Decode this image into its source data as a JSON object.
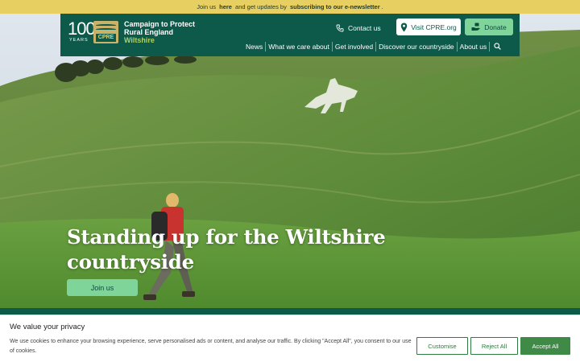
{
  "topbar": {
    "prefix": "Join us",
    "here_link": "here",
    "middle": "and get updates by",
    "subscribe_link": "subscribing to our e-newsletter",
    "suffix": "."
  },
  "logo": {
    "number": "100",
    "years": "YEARS",
    "badge": "CPRE"
  },
  "org": {
    "line1": "Campaign to Protect",
    "line2": "Rural England",
    "line3": "Wiltshire"
  },
  "header": {
    "contact_label": "Contact us",
    "visit_label": "Visit CPRE.org",
    "donate_label": "Donate"
  },
  "nav": {
    "items": [
      "News",
      "What we care about",
      "Get involved",
      "Discover our countryside",
      "About us"
    ]
  },
  "hero": {
    "headline_line1": "Standing up for the Wiltshire",
    "headline_line2": "countryside",
    "join_label": "Join us"
  },
  "cookie": {
    "title": "We value your privacy",
    "text": "We use cookies to enhance your browsing experience, serve personalised ads or content, and analyse our traffic. By clicking \"Accept All\", you consent to our use of cookies.",
    "customise": "Customise",
    "reject": "Reject All",
    "accept": "Accept All"
  },
  "colors": {
    "header_green": "#0e5a4a",
    "topbar_yellow": "#e8cf62",
    "accent_mint": "#7fd49a",
    "cookie_green": "#3f8a46"
  },
  "icons": [
    "phone-icon",
    "map-pin-icon",
    "donate-hand-icon",
    "search-icon"
  ]
}
